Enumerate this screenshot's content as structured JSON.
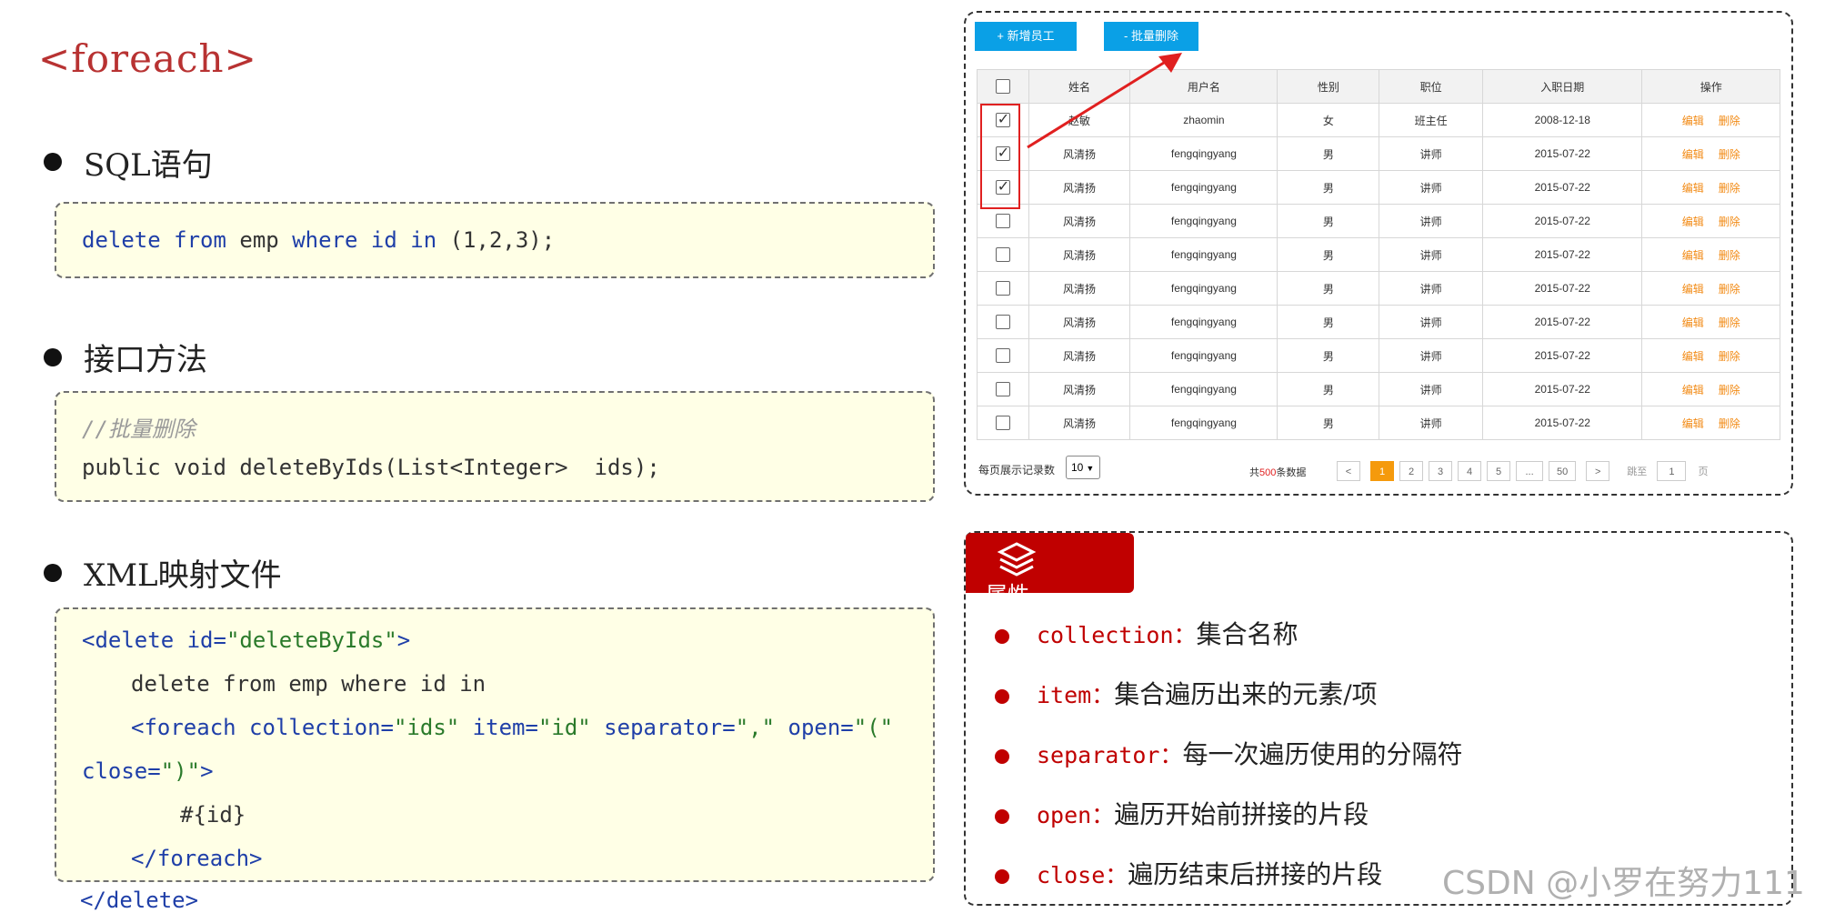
{
  "slide": {
    "title": "<foreach>",
    "sections": [
      {
        "label": "SQL语句"
      },
      {
        "label": "接口方法"
      },
      {
        "label": "XML映射文件"
      }
    ],
    "sql": {
      "kw1": "delete",
      "kw2": "from",
      "t1": " emp ",
      "kw3": "where",
      "kw4": " id ",
      "kw5": "in",
      "rest": " (1,2,3);"
    },
    "iface": {
      "comment": "//批量删除",
      "line": "public void deleteByIds(List<Integer>  ids);"
    },
    "xml": {
      "l1a": "<delete id=",
      "l1b": "\"deleteByIds\"",
      "l1c": ">",
      "l2": "delete from emp where id in",
      "l3a": "<foreach collection=",
      "l3b": "\"ids\"",
      "l3c": " item=",
      "l3d": "\"id\"",
      "l3e": " separator=",
      "l3f": "\",\"",
      "l3g": " open=",
      "l3h": "\"(\"",
      "l4a": "close=",
      "l4b": "\")\"",
      "l4c": ">",
      "l5": "#{id}",
      "l6": "</foreach>",
      "l7": "</delete>"
    }
  },
  "table_panel": {
    "add_button": "+ 新增员工",
    "batch_delete_button": "- 批量删除",
    "columns": [
      "姓名",
      "用户名",
      "性别",
      "职位",
      "入职日期",
      "操作"
    ],
    "rows": [
      {
        "checked": true,
        "name": "赵敏",
        "username": "zhaomin",
        "gender": "女",
        "position": "班主任",
        "date": "2008-12-18",
        "edit": "编辑",
        "del": "删除"
      },
      {
        "checked": true,
        "name": "风清扬",
        "username": "fengqingyang",
        "gender": "男",
        "position": "讲师",
        "date": "2015-07-22",
        "edit": "编辑",
        "del": "删除"
      },
      {
        "checked": true,
        "name": "风清扬",
        "username": "fengqingyang",
        "gender": "男",
        "position": "讲师",
        "date": "2015-07-22",
        "edit": "编辑",
        "del": "删除"
      },
      {
        "checked": false,
        "name": "风清扬",
        "username": "fengqingyang",
        "gender": "男",
        "position": "讲师",
        "date": "2015-07-22",
        "edit": "编辑",
        "del": "删除"
      },
      {
        "checked": false,
        "name": "风清扬",
        "username": "fengqingyang",
        "gender": "男",
        "position": "讲师",
        "date": "2015-07-22",
        "edit": "编辑",
        "del": "删除"
      },
      {
        "checked": false,
        "name": "风清扬",
        "username": "fengqingyang",
        "gender": "男",
        "position": "讲师",
        "date": "2015-07-22",
        "edit": "编辑",
        "del": "删除"
      },
      {
        "checked": false,
        "name": "风清扬",
        "username": "fengqingyang",
        "gender": "男",
        "position": "讲师",
        "date": "2015-07-22",
        "edit": "编辑",
        "del": "删除"
      },
      {
        "checked": false,
        "name": "风清扬",
        "username": "fengqingyang",
        "gender": "男",
        "position": "讲师",
        "date": "2015-07-22",
        "edit": "编辑",
        "del": "删除"
      },
      {
        "checked": false,
        "name": "风清扬",
        "username": "fengqingyang",
        "gender": "男",
        "position": "讲师",
        "date": "2015-07-22",
        "edit": "编辑",
        "del": "删除"
      },
      {
        "checked": false,
        "name": "风清扬",
        "username": "fengqingyang",
        "gender": "男",
        "position": "讲师",
        "date": "2015-07-22",
        "edit": "编辑",
        "del": "删除"
      }
    ],
    "pagination": {
      "per_page_label": "每页展示记录数",
      "per_page_value": "10",
      "total_prefix": "共",
      "total_count": "500",
      "total_suffix": "条数据",
      "prev": "<",
      "pages": [
        "1",
        "2",
        "3",
        "4",
        "5",
        "...",
        "50"
      ],
      "current_page": "1",
      "next": ">",
      "jump_label": "跳至",
      "jump_value": "1",
      "page_unit": "页"
    },
    "colors": {
      "button": "#0aa0e6",
      "op": "#f28a14",
      "active_page": "#f59a0c",
      "highlight": "#e02020"
    }
  },
  "props_panel": {
    "tab_label": "属性",
    "tab_icon": "layers-icon",
    "items": [
      {
        "key": "collection：",
        "desc": "集合名称"
      },
      {
        "key": "item：",
        "desc": "集合遍历出来的元素/项"
      },
      {
        "key": "separator：",
        "desc": "每一次遍历使用的分隔符"
      },
      {
        "key": "open：",
        "desc": "遍历开始前拼接的片段"
      },
      {
        "key": "close：",
        "desc": "遍历结束后拼接的片段"
      }
    ],
    "colors": {
      "accent": "#c00000"
    }
  },
  "watermark": "CSDN @小罗在努力111"
}
